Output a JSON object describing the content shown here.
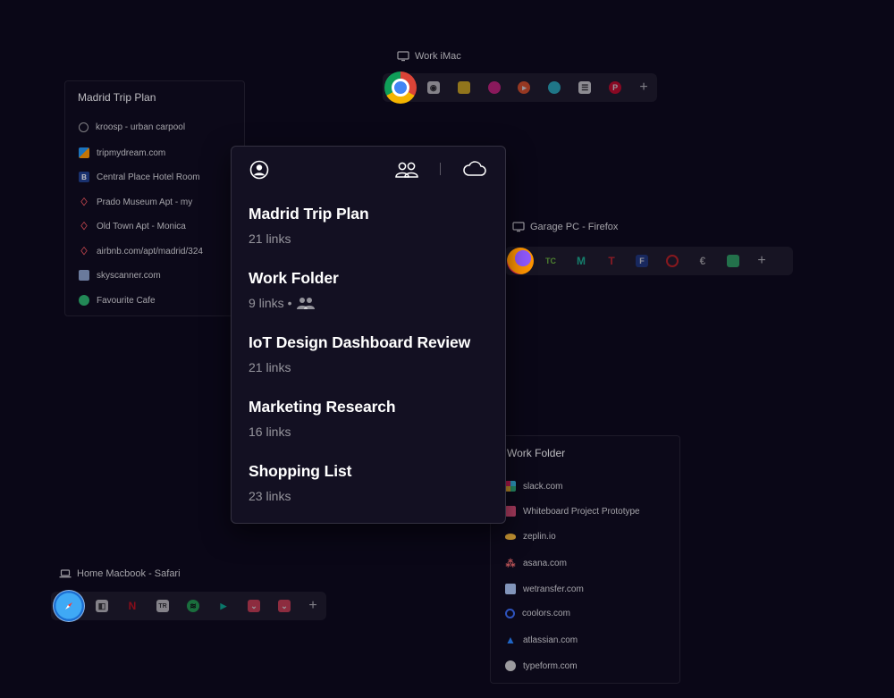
{
  "devices": {
    "imac": {
      "label": "Work iMac",
      "browser_icon": "chrome-icon"
    },
    "garage": {
      "label": "Garage PC - Firefox",
      "browser_icon": "firefox-icon"
    },
    "macbook": {
      "label": "Home Macbook - Safari",
      "browser_icon": "safari-icon"
    }
  },
  "dock_plus": "+",
  "madrid_card": {
    "title": "Madrid Trip Plan",
    "links": [
      "kroosp - urban carpool",
      "tripmydream.com",
      "Central Place Hotel Room",
      "Prado Museum Apt - my",
      "Old Town Apt - Monica",
      "airbnb.com/apt/madrid/324",
      "skyscanner.com",
      "Favourite Cafe"
    ]
  },
  "work_card": {
    "title": "Work Folder",
    "links": [
      "slack.com",
      "Whiteboard Project Prototype",
      "zeplin.io",
      "asana.com",
      "wetransfer.com",
      "coolors.com",
      "atlassian.com",
      "typeform.com"
    ]
  },
  "panel": {
    "toolbar_icons": [
      "user-icon",
      "shared-users-icon",
      "cloud-icon"
    ],
    "collections": [
      {
        "name": "Madrid Trip Plan",
        "meta": "21 links",
        "shared": false
      },
      {
        "name": "Work Folder",
        "meta": "9 links •",
        "shared": true
      },
      {
        "name": "IoT Design Dashboard Review",
        "meta": "21 links",
        "shared": false
      },
      {
        "name": "Marketing Research",
        "meta": "16 links",
        "shared": false
      },
      {
        "name": "Shopping List",
        "meta": "23 links",
        "shared": false
      }
    ]
  }
}
